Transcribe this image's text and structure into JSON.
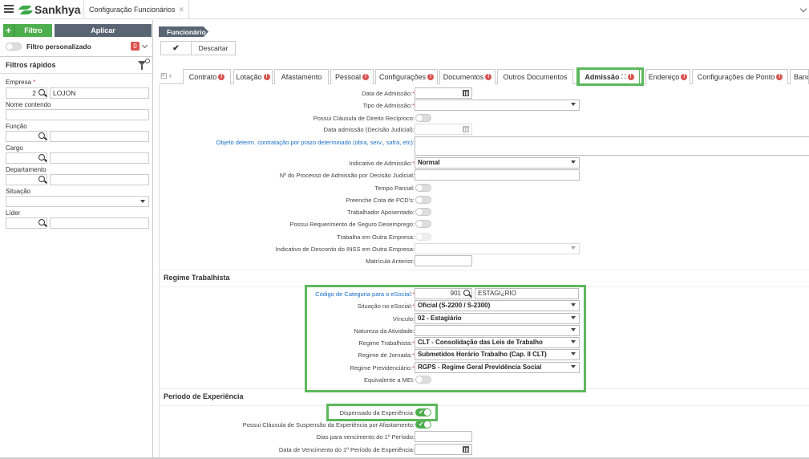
{
  "topbar": {
    "logo_text": "Sankhya",
    "tab_title": "Configuração Funcionários",
    "tab_close": "✕"
  },
  "sidebar": {
    "filter_button": "Filtro",
    "filter_plus": "+",
    "apply_button": "Aplicar",
    "custom_filter_label": "Filtro personalizado",
    "custom_filter_count": "0",
    "quick_filters_title": "Filtros rápidos",
    "fields": {
      "empresa_label": "Empresa",
      "empresa_code": "2",
      "empresa_name": "LOJON",
      "nome_label": "Nome contendo",
      "funcao_label": "Função",
      "cargo_label": "Cargo",
      "departamento_label": "Departamento",
      "situacao_label": "Situação",
      "lider_label": "Líder"
    }
  },
  "main": {
    "breadcrumb": "Funcionário",
    "confirm_icon": "✔",
    "discard_button": "Descartar",
    "tab_lead": "◰ ‹",
    "tabs": [
      {
        "label": "Contrato",
        "error": true
      },
      {
        "label": "Lotação",
        "error": true
      },
      {
        "label": "Afastamento",
        "error": false
      },
      {
        "label": "Pessoal",
        "error": true
      },
      {
        "label": "Configurações",
        "error": true
      },
      {
        "label": "Documentos",
        "error": true
      },
      {
        "label": "Outros Documentos",
        "error": false
      },
      {
        "label": "Admissão",
        "error": true,
        "active": true
      },
      {
        "label": "Endereço",
        "error": true
      },
      {
        "label": "Configurações de Ponto",
        "error": true
      },
      {
        "label": "Banc",
        "error": false
      }
    ],
    "tab_error_mark": "!",
    "expand_icon": "⛶"
  },
  "form": {
    "data_admissao": "Data de Admissão:",
    "tipo_admissao": "Tipo de Admissão:",
    "clausula_reciproco": "Possui Cláusula de Direito Recíproco:",
    "data_adm_judicial": "Data admissão (Decisão Judicial):",
    "objeto_determ": "Objeto determ. contratação por prazo determinado (obra, serv., safra, etc):",
    "indicativo_admissao": "Indicativo de Admissão:",
    "indicativo_admissao_value": "Normal",
    "processo_admissao": "Nº do Processo de Admissão por Decisão Judicial:",
    "tempo_parcial": "Tempo Parcial:",
    "cota_pcd": "Preenche Cota de PCD's:",
    "aposentado": "Trabalhador Aposentado:",
    "seguro_desemprego": "Possui Requerimento de Seguro Desemprego:",
    "outra_empresa": "Trabalha em Outra Empresa:",
    "desconto_inss": "Indicativo de Desconto do INSS em Outra Empresa:",
    "matricula_anterior": "Matrícula Anterior:",
    "regime_title": "Regime Trabalhista",
    "codigo_categoria": "Código de Categoria para o eSocial:",
    "codigo_categoria_code": "901",
    "codigo_categoria_name": "ESTAGI¿RIO",
    "situacao_esocial": "Situação no eSocial:",
    "situacao_esocial_value": "Oficial (S-2200 / S-2300)",
    "vinculo": "Vínculo:",
    "vinculo_value": "02 - Estagiário",
    "natureza_atividade": "Natureza da Atividade:",
    "regime_trabalhista": "Regime Trabalhista:",
    "regime_trabalhista_value": "CLT - Consolidação das Leis de Trabalho",
    "regime_jornada": "Regime de Jornada:",
    "regime_jornada_value": "Submetidos Horário Trabalho (Cap. II CLT)",
    "regime_previdenciario": "Regime Previdenciário:",
    "regime_previdenciario_value": "RGPS - Regime Geral Previdência Social",
    "equivalente_mei": "Equivalente a MEI:",
    "experiencia_title": "Periodo de Experiência",
    "dispensado_experiencia": "Dispensado da Experiência:",
    "clausula_suspensao": "Possui Cláusula de Suspensão da Experiência por Afastamento:",
    "dias_vencimento": "Dias para vencimento do 1º Período:",
    "data_vencimento": "Data de Vencimento do 1º Período de Experiência:",
    "required_mark": "*",
    "check_mark": "✔"
  },
  "colors": {
    "accent_green": "#5cb85c",
    "header_gray": "#596573",
    "error_red": "#d9534f",
    "link_blue": "#1a6fc9"
  }
}
